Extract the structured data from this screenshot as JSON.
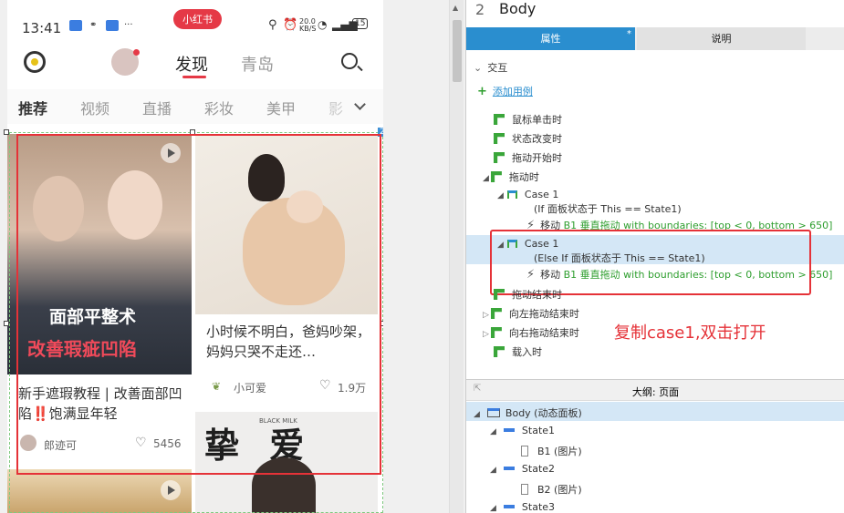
{
  "phone": {
    "status": {
      "time": "13:41",
      "app_pill": "小红书",
      "net_speed": "20.0\nKB/S",
      "battery": "15"
    },
    "top_nav": {
      "discover": "发现",
      "city": "青岛"
    },
    "categories": [
      "推荐",
      "视频",
      "直播",
      "彩妆",
      "美甲",
      "影"
    ],
    "cards": [
      {
        "overlay_line1": "面部平整术",
        "overlay_line2": "改善瑕疵凹陷",
        "title": "新手遮瑕教程 | 改善面部凹陷‼️饱满显年轻",
        "author": "郎迹可",
        "likes": "5456"
      },
      {
        "title": "小时候不明白，爸妈吵架，妈妈只哭不走还…",
        "author": "小可爱",
        "likes": "1.9万"
      },
      {
        "overlay": "挚 爱",
        "tag": "BLACK MILK"
      }
    ],
    "panel_badge": "2"
  },
  "panel": {
    "header_num": "2",
    "header_title": "Body",
    "tab_properties": "属性",
    "tab_star": "*",
    "tab_notes": "说明",
    "section_interaction": "交互",
    "add_case": "添加用例",
    "events": [
      "鼠标单击时",
      "状态改变时",
      "拖动开始时",
      "拖动时"
    ],
    "case1": {
      "name": "Case 1",
      "cond": "(If 面板状态于 This == State1)",
      "action_prefix": "移动",
      "action": "B1 垂直拖动 with boundaries: [top < 0, bottom > 650]"
    },
    "case2": {
      "name": "Case 1",
      "cond": "(Else If 面板状态于 This == State1)",
      "action_prefix": "移动",
      "action": "B1 垂直拖动 with boundaries: [top < 0, bottom > 650]"
    },
    "events_after": [
      "拖动结束时",
      "向左拖动结束时",
      "向右拖动结束时",
      "载入时"
    ],
    "annotation": "复制case1,双击打开",
    "outline_title": "大纲: 页面",
    "outline": [
      {
        "label": "Body (动态面板)",
        "level": 0,
        "kind": "panel"
      },
      {
        "label": "State1",
        "level": 1,
        "kind": "state"
      },
      {
        "label": "B1 (图片)",
        "level": 2,
        "kind": "image"
      },
      {
        "label": "State2",
        "level": 1,
        "kind": "state"
      },
      {
        "label": "B2 (图片)",
        "level": 2,
        "kind": "image"
      },
      {
        "label": "State3",
        "level": 1,
        "kind": "state"
      }
    ]
  },
  "colors": {
    "accent": "#2a8ecf",
    "highlight": "#d4e7f6",
    "red": "#e53238",
    "green": "#2e9e2e"
  }
}
